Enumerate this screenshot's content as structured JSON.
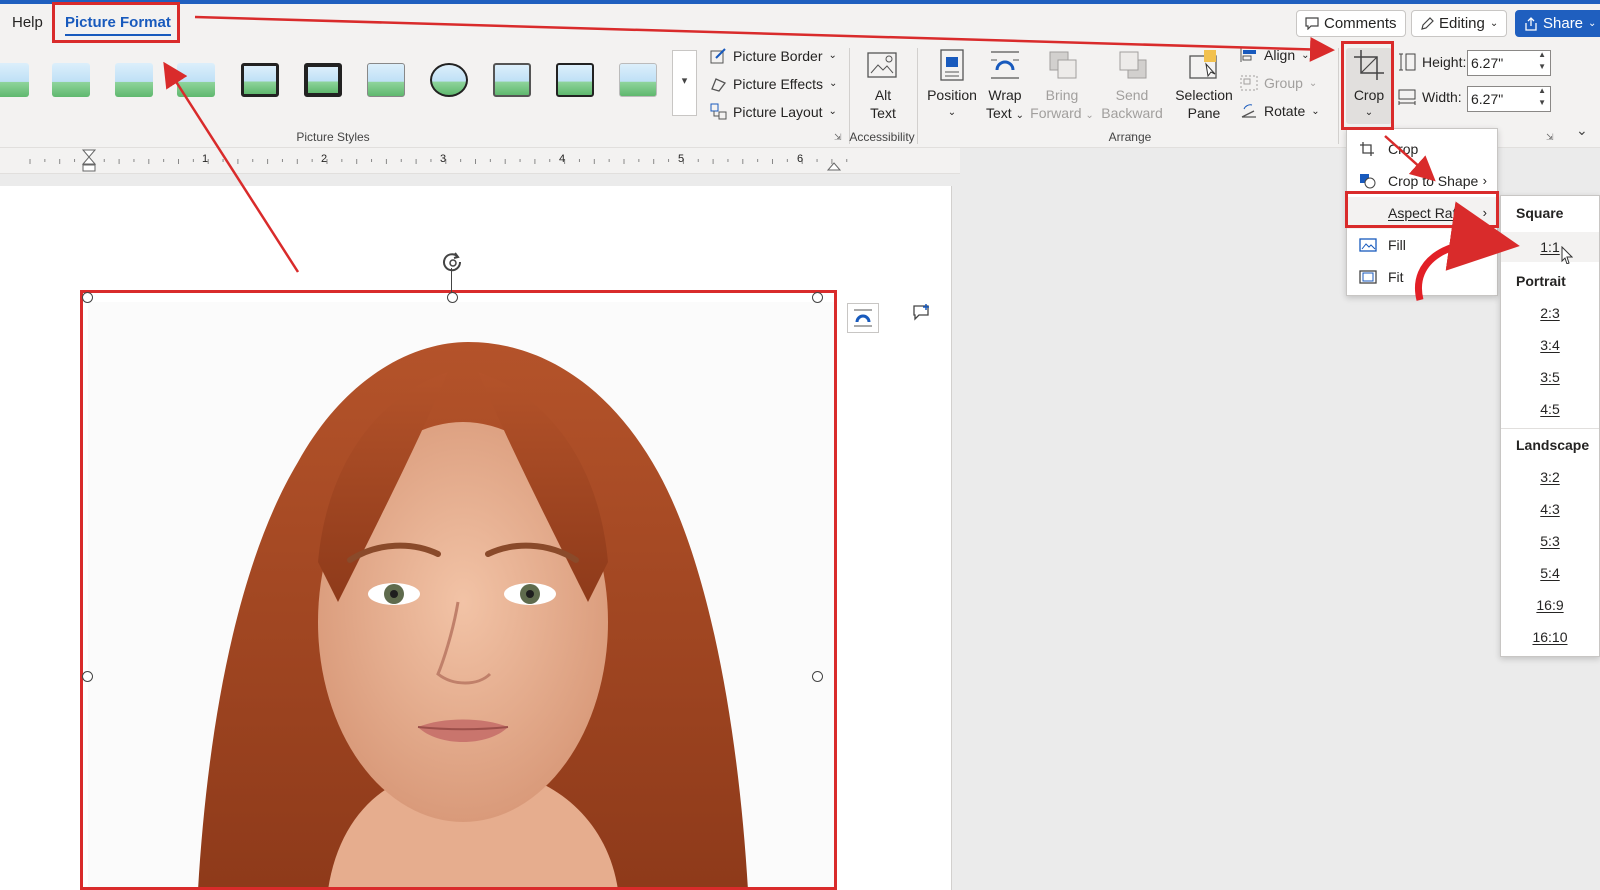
{
  "tabs": {
    "help": "Help",
    "picture_format": "Picture Format"
  },
  "topbar": {
    "comments": "Comments",
    "editing": "Editing",
    "share": "Share"
  },
  "ribbon": {
    "picture_border": "Picture Border",
    "picture_effects": "Picture Effects",
    "picture_layout": "Picture Layout",
    "picture_styles_label": "Picture Styles",
    "alt_text": [
      "Alt",
      "Text"
    ],
    "accessibility_label": "Accessibility",
    "position": "Position",
    "wrap_text": [
      "Wrap",
      "Text"
    ],
    "bring_forward": [
      "Bring",
      "Forward"
    ],
    "send_backward": [
      "Send",
      "Backward"
    ],
    "selection_pane": [
      "Selection",
      "Pane"
    ],
    "align": "Align",
    "group": "Group",
    "rotate": "Rotate",
    "arrange_label": "Arrange",
    "crop": "Crop",
    "height_label": "Height:",
    "height_value": "6.27\"",
    "width_label": "Width:",
    "width_value": "6.27\""
  },
  "ruler": {
    "numbers": [
      "1",
      "2",
      "3",
      "4",
      "5",
      "6"
    ]
  },
  "crop_menu": {
    "items": [
      "Crop",
      "Crop to Shape",
      "Aspect Ratio",
      "Fill",
      "Fit"
    ]
  },
  "aspect_menu": {
    "square_header": "Square",
    "square": [
      "1:1"
    ],
    "portrait_header": "Portrait",
    "portrait": [
      "2:3",
      "3:4",
      "3:5",
      "4:5"
    ],
    "landscape_header": "Landscape",
    "landscape": [
      "3:2",
      "4:3",
      "5:3",
      "5:4",
      "16:9",
      "16:10"
    ]
  },
  "colors": {
    "accent": "#185abd",
    "annotation": "#d92b2b"
  }
}
